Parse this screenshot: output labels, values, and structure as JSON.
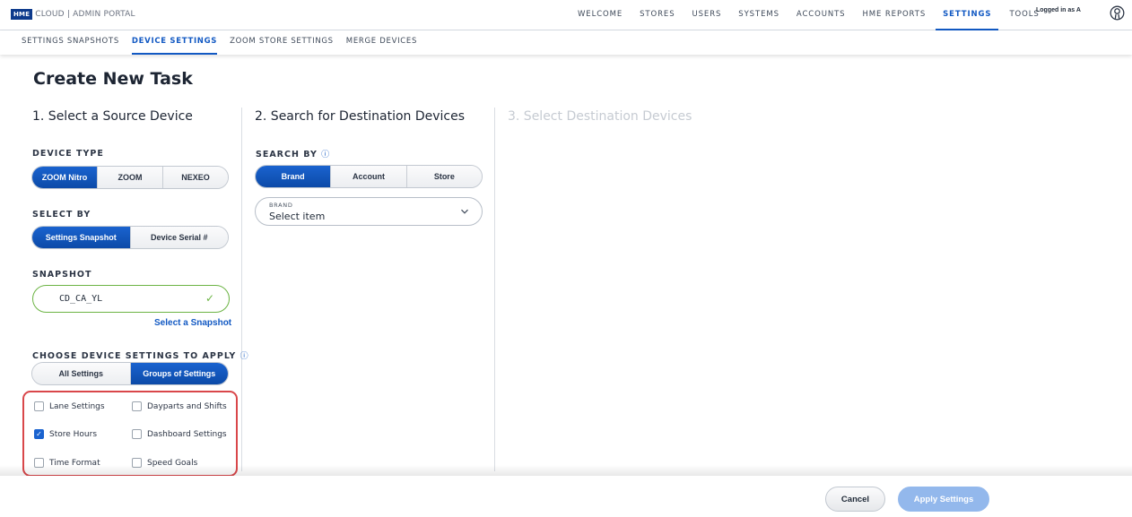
{
  "brand": {
    "badge": "HME",
    "text": "CLOUD | ADMIN PORTAL"
  },
  "nav": {
    "items": [
      {
        "label": "WELCOME"
      },
      {
        "label": "STORES"
      },
      {
        "label": "USERS"
      },
      {
        "label": "SYSTEMS"
      },
      {
        "label": "ACCOUNTS"
      },
      {
        "label": "HME REPORTS"
      },
      {
        "label": "SETTINGS",
        "active": true
      },
      {
        "label": "TOOLS"
      }
    ],
    "logged_in": "Logged in as A",
    "user_icon": "user-circle-icon"
  },
  "subnav": {
    "items": [
      {
        "label": "SETTINGS SNAPSHOTS"
      },
      {
        "label": "DEVICE SETTINGS",
        "active": true
      },
      {
        "label": "ZOOM STORE SETTINGS"
      },
      {
        "label": "MERGE DEVICES"
      }
    ]
  },
  "page": {
    "title": "Create New Task"
  },
  "step1": {
    "title": "1. Select a Source Device",
    "device_type_label": "DEVICE TYPE",
    "device_types": [
      "ZOOM Nitro",
      "ZOOM",
      "NEXEO"
    ],
    "device_type_selected": "ZOOM Nitro",
    "select_by_label": "SELECT BY",
    "select_by": [
      "Settings Snapshot",
      "Device Serial #"
    ],
    "select_by_selected": "Settings Snapshot",
    "snapshot_label": "SNAPSHOT",
    "snapshot_value": "CD_CA_YL",
    "select_snapshot_link": "Select a Snapshot",
    "apply_label": "CHOOSE DEVICE SETTINGS TO APPLY",
    "apply_options": [
      "All Settings",
      "Groups of Settings"
    ],
    "apply_selected": "Groups of Settings",
    "groups": [
      {
        "label": "Lane Settings",
        "checked": false
      },
      {
        "label": "Dayparts and Shifts",
        "checked": false
      },
      {
        "label": "Store Hours",
        "checked": true
      },
      {
        "label": "Dashboard Settings",
        "checked": false
      },
      {
        "label": "Time Format",
        "checked": false
      },
      {
        "label": "Speed Goals",
        "checked": false
      }
    ]
  },
  "step2": {
    "title": "2. Search for Destination Devices",
    "search_by_label": "SEARCH BY",
    "search_by": [
      "Brand",
      "Account",
      "Store"
    ],
    "search_by_selected": "Brand",
    "dropdown_label": "BRAND",
    "dropdown_value": "Select item"
  },
  "step3": {
    "title": "3. Select Destination Devices"
  },
  "footer": {
    "cancel": "Cancel",
    "apply": "Apply Settings"
  },
  "colors": {
    "accent": "#1259c3",
    "success": "#6cb444",
    "highlight": "#d9474a",
    "apply_disabled": "#93b8ec"
  }
}
